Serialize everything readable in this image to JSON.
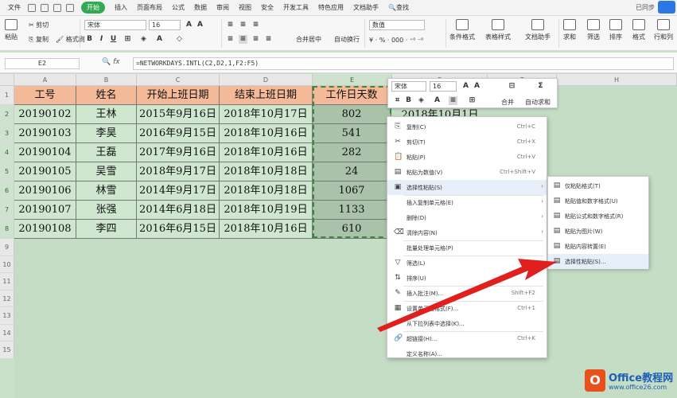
{
  "menubar": {
    "file": "文件",
    "tabs": [
      "开始",
      "插入",
      "页面布局",
      "公式",
      "数据",
      "审阅",
      "视图",
      "安全",
      "开发工具",
      "特色应用",
      "文档助手"
    ],
    "active_tab": "开始",
    "search": "查找",
    "sync": "已同步"
  },
  "ribbon": {
    "paste": "粘贴",
    "cut": "剪切",
    "copy": "复制",
    "format_painter": "格式刷",
    "font_name": "宋体",
    "font_size": "16",
    "bold": "B",
    "italic": "I",
    "underline": "U",
    "merge_center": "合并居中",
    "wrap_text": "自动换行",
    "number_format": "数值",
    "cond_format": "条件格式",
    "table_style": "表格样式",
    "doc_assistant": "文档助手",
    "sum": "求和",
    "filter": "筛选",
    "sort": "排序",
    "format": "格式",
    "row_col": "行和列"
  },
  "formula_bar": {
    "cell_ref": "E2",
    "fx": "fx",
    "formula": "=NETWORKDAYS.INTL(C2,D2,1,F2:F5)"
  },
  "grid": {
    "columns": [
      "A",
      "B",
      "C",
      "D",
      "E",
      "F",
      "G",
      "H"
    ],
    "rows": [
      "1",
      "2",
      "3",
      "4",
      "5",
      "6",
      "7",
      "8",
      "9",
      "10",
      "11",
      "12",
      "13",
      "14",
      "15"
    ],
    "header": [
      "工号",
      "姓名",
      "开始上班日期",
      "结束上班日期",
      "工作日天数"
    ],
    "data": [
      [
        "20190102",
        "王林",
        "2015年9月16日",
        "2018年10月17日",
        "802"
      ],
      [
        "20190103",
        "李昊",
        "2016年9月15日",
        "2018年10月16日",
        "541"
      ],
      [
        "20190104",
        "王磊",
        "2017年9月16日",
        "2018年10月16日",
        "282"
      ],
      [
        "20190105",
        "吴雪",
        "2018年9月17日",
        "2018年10月18日",
        "24"
      ],
      [
        "20190106",
        "林雪",
        "2014年9月17日",
        "2018年10月18日",
        "1067"
      ],
      [
        "20190107",
        "张强",
        "2014年6月18日",
        "2018年10月19日",
        "1133"
      ],
      [
        "20190108",
        "李四",
        "2016年6月15日",
        "2018年10月16日",
        "610"
      ]
    ],
    "g2": "2018年10月1日"
  },
  "mini_toolbar": {
    "font": "宋体",
    "size": "16",
    "merge": "合并",
    "auto_sum": "自动求和"
  },
  "context_menu": {
    "items": [
      {
        "icon": "copy-icon",
        "glyph": "⎘",
        "label": "复制(C)",
        "shortcut": "Ctrl+C"
      },
      {
        "icon": "cut-icon",
        "glyph": "✂",
        "label": "剪切(T)",
        "shortcut": "Ctrl+X"
      },
      {
        "icon": "paste-icon",
        "glyph": "📋",
        "label": "粘贴(P)",
        "shortcut": "Ctrl+V"
      },
      {
        "icon": "paste-values-icon",
        "glyph": "▤",
        "label": "粘贴为数值(V)",
        "shortcut": "Ctrl+Shift+V"
      },
      {
        "icon": "paste-special-icon",
        "glyph": "▣",
        "label": "选择性粘贴(S)",
        "shortcut": ""
      },
      {
        "icon": "",
        "glyph": "",
        "label": "插入复制单元格(E)",
        "shortcut": ""
      },
      {
        "icon": "",
        "glyph": "",
        "label": "删除(D)",
        "shortcut": ""
      },
      {
        "icon": "clear-icon",
        "glyph": "⌫",
        "label": "清除内容(N)",
        "shortcut": ""
      },
      {
        "icon": "",
        "glyph": "",
        "label": "批量处理单元格(P)",
        "shortcut": ""
      },
      {
        "icon": "filter-icon",
        "glyph": "▽",
        "label": "筛选(L)",
        "shortcut": ""
      },
      {
        "icon": "sort-icon",
        "glyph": "⇅",
        "label": "排序(U)",
        "shortcut": ""
      },
      {
        "icon": "comment-icon",
        "glyph": "✎",
        "label": "插入批注(M)...",
        "shortcut": "Shift+F2"
      },
      {
        "icon": "format-cells-icon",
        "glyph": "▦",
        "label": "设置单元格格式(F)...",
        "shortcut": "Ctrl+1"
      },
      {
        "icon": "",
        "glyph": "",
        "label": "从下拉列表中选择(K)...",
        "shortcut": ""
      },
      {
        "icon": "link-icon",
        "glyph": "🔗",
        "label": "超链接(H)...",
        "shortcut": "Ctrl+K"
      },
      {
        "icon": "",
        "glyph": "",
        "label": "定义名称(A)...",
        "shortcut": ""
      }
    ]
  },
  "submenu": {
    "items": [
      {
        "label": "仅粘贴格式(T)"
      },
      {
        "label": "粘贴值和数字格式(U)"
      },
      {
        "label": "粘贴公式和数字格式(R)"
      },
      {
        "label": "粘贴为图片(W)"
      },
      {
        "label": "粘贴内容转置(E)"
      },
      {
        "label": "选择性粘贴(S)..."
      }
    ]
  },
  "watermark": {
    "icon_letter": "O",
    "title": "Office教程网",
    "url": "www.office26.com"
  },
  "colors": {
    "header_fill": "#f3b998",
    "body_fill": "#cfe6cf",
    "sheet_bg": "#c5ddc5",
    "arrow": "#e0201e",
    "accent": "#34a853"
  }
}
